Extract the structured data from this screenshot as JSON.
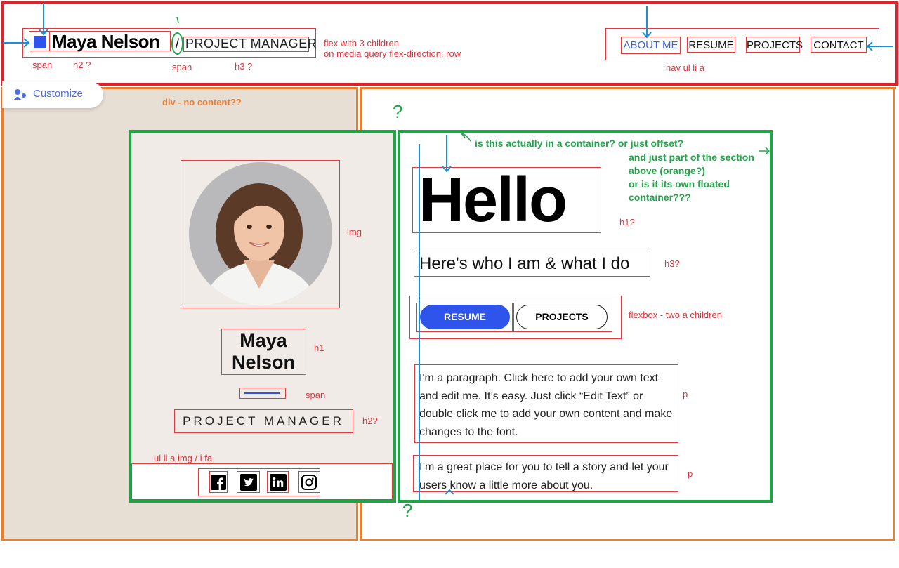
{
  "header": {
    "brand_name": "Maya Nelson",
    "slash": "/",
    "role": "PROJECT MANAGER",
    "nav": [
      {
        "label": "ABOUT ME"
      },
      {
        "label": "RESUME"
      },
      {
        "label": "PROJECTS"
      },
      {
        "label": "CONTACT"
      }
    ]
  },
  "customize": {
    "label": "Customize"
  },
  "card": {
    "name_line1": "Maya",
    "name_line2": "Nelson",
    "role": "PROJECT MANAGER",
    "social_icons": [
      "facebook-icon",
      "twitter-icon",
      "linkedin-icon",
      "instagram-icon"
    ]
  },
  "main": {
    "hello": "Hello",
    "subtitle": "Here's who I am & what I do",
    "buttons": {
      "resume": "RESUME",
      "projects": "PROJECTS"
    },
    "paragraph1": "I'm a paragraph. Click here to add your own text and edit me. It’s easy. Just click “Edit Text” or double click me to add your own content and make changes to the font.",
    "paragraph2": "I’m a great place for you to tell a story and let your users know a little more about you."
  },
  "annotations": {
    "span1": "span",
    "h2q": "h2 ?",
    "span2": "span",
    "h3q": "h3 ?",
    "flex_note_1": "flex with 3 children",
    "flex_note_2": "on media query flex-direction: row",
    "nav_note": "nav ul li a",
    "div_note": "div - no content??",
    "q_top": "?",
    "container_q": "is this actually in a container? or just offset?",
    "section_q_1": "and just part of the section",
    "section_q_2": "above (orange?)",
    "section_q_3": "or is it its own floated",
    "section_q_4": "container???",
    "img": "img",
    "h1q": "h1?",
    "h3q2": "h3?",
    "flexbox_note": "flexbox - two a children",
    "h1": "h1",
    "span3": "span",
    "h2q2": "h2?",
    "ul_note": "ul li a img / i fa",
    "p1": "p",
    "p2": "p",
    "q_bottom": "?"
  },
  "colors": {
    "header_outline": "#e5202a",
    "section_outline": "#ef7d2e",
    "container_outline": "#1fa446",
    "accent_blue": "#2f54eb",
    "annotation_red": "#d9363e",
    "annotation_arrow": "#1a8fd6"
  }
}
